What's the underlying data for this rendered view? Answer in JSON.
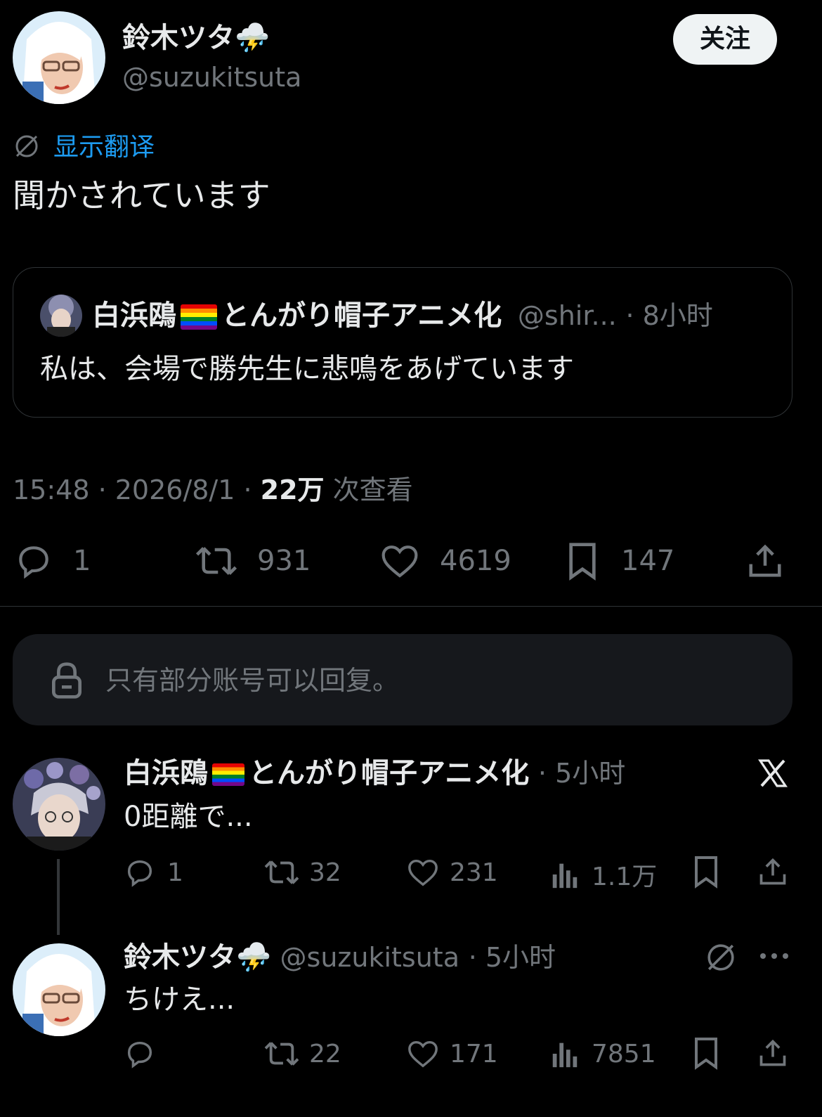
{
  "main_tweet": {
    "author_name": "鈴木ツタ",
    "author_emoji": "⛈️",
    "handle": "@suzukitsuta",
    "follow_label": "关注",
    "translate_label": "显示翻译",
    "text": "聞かされています",
    "timestamp": "15:48 · 2026/8/1 ·",
    "views_count": "22万",
    "views_label": "次查看",
    "replies": "1",
    "retweets": "931",
    "likes": "4619",
    "bookmarks": "147"
  },
  "quoted_tweet": {
    "name_part1": "白浜鴎",
    "name_part2": "とんがり帽子アニメ化",
    "handle": "@shir...",
    "time": "· 8小时",
    "text": "私は、会場で勝先生に悲鳴をあげています"
  },
  "reply_restriction": {
    "text": "只有部分账号可以回复。"
  },
  "replies": [
    {
      "name_part1": "白浜鴎",
      "name_part2": "とんがり帽子アニメ化",
      "time": "· 5小时",
      "text": "0距離で...",
      "replies": "1",
      "retweets": "32",
      "likes": "231",
      "views": "1.1万"
    },
    {
      "name": "鈴木ツタ",
      "emoji": "⛈️",
      "handle": "@suzukitsuta",
      "time": "· 5小时",
      "text": "ちけえ...",
      "replies": "",
      "retweets": "22",
      "likes": "171",
      "views": "7851"
    }
  ],
  "icons": [
    "translate-off-icon",
    "reply-icon",
    "retweet-icon",
    "like-icon",
    "bookmark-icon",
    "share-icon",
    "lock-icon",
    "views-icon",
    "x-logo-icon",
    "more-icon"
  ]
}
